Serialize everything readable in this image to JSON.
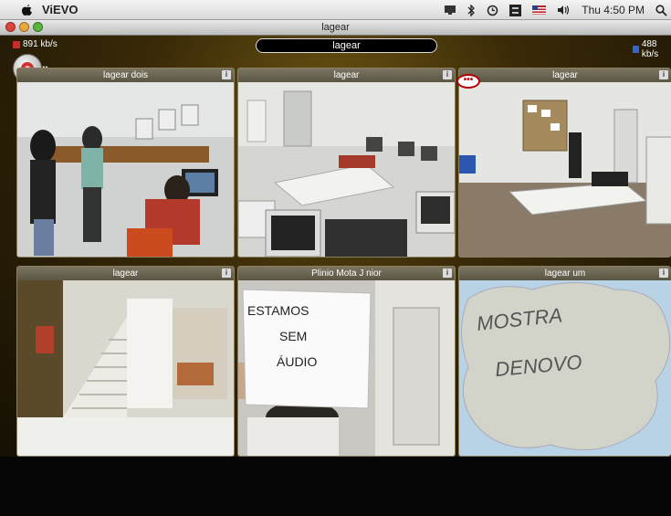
{
  "menubar": {
    "app_name": "ViEVO",
    "clock": "Thu 4:50 PM",
    "icons": [
      "apple-icon",
      "display-icon",
      "bluetooth-icon",
      "time-machine-icon",
      "input-menu-icon",
      "flag-icon",
      "volume-icon",
      "spotlight-icon"
    ]
  },
  "window": {
    "title": "lagear",
    "conference_title": "lagear",
    "bitrate_out": "891 kb/s",
    "bitrate_in": "488 kb/s",
    "bubble_text": "•••"
  },
  "tiles": [
    {
      "title": "lagear dois"
    },
    {
      "title": "lagear"
    },
    {
      "title": "lagear"
    },
    {
      "title": "lagear"
    },
    {
      "title": "Plinio Mota J nior"
    },
    {
      "title": "lagear um"
    }
  ],
  "sign_paper": [
    "ESTAMOS",
    "SEM",
    "ÁUDIO"
  ],
  "sign_cloud": [
    "MOSTRA",
    "DENOVO"
  ],
  "colors": {
    "accent_red": "#cc2b2b",
    "frame_gold": "#8a8060"
  }
}
